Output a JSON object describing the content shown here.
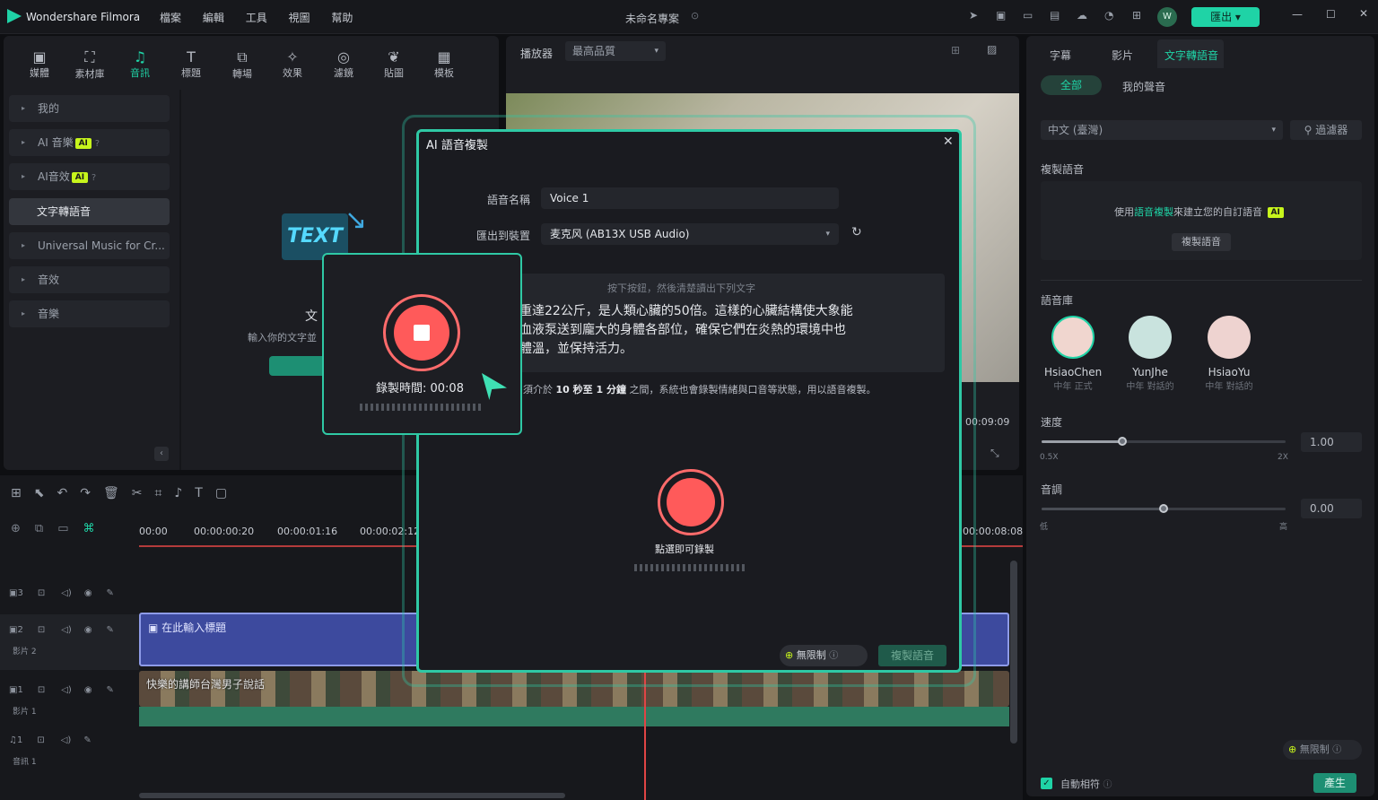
{
  "app": {
    "name": "Wondershare Filmora",
    "menu": [
      "檔案",
      "編輯",
      "工具",
      "視圖",
      "幫助"
    ],
    "project_title": "未命名專案",
    "export_label": "匯出",
    "user_initial": "W"
  },
  "toolbar": {
    "items": [
      "媒體",
      "素材庫",
      "音訊",
      "標題",
      "轉場",
      "效果",
      "濾鏡",
      "貼圖",
      "模板"
    ],
    "active": "音訊"
  },
  "library": {
    "categories": [
      {
        "label": "我的",
        "ai": false
      },
      {
        "label": "AI 音樂",
        "ai": true
      },
      {
        "label": "AI音效",
        "ai": true
      },
      {
        "label": "文字轉語音",
        "ai": false,
        "selected": true
      },
      {
        "label": "Universal Music for Cr...",
        "ai": false
      },
      {
        "label": "音效",
        "ai": false
      },
      {
        "label": "音樂",
        "ai": false
      }
    ],
    "ai_badge": "AI",
    "promo_title": "文",
    "promo_sub": "輸入你的文字並",
    "text_logo": "TEXT"
  },
  "player": {
    "label": "播放器",
    "quality": "最高品質",
    "time": "00:09:09"
  },
  "timeline": {
    "ticks": [
      "00:00",
      "00:00:00:20",
      "00:00:01:16",
      "00:00:02:12",
      "00:00:08:08"
    ],
    "tracks": [
      {
        "num": "3",
        "name": ""
      },
      {
        "num": "2",
        "name": "影片 2"
      },
      {
        "num": "1",
        "name": "影片 1"
      },
      {
        "num": "1",
        "name": "音訊 1"
      }
    ],
    "title_clip": "在此輸入標題",
    "video_clip": "快樂的講師台灣男子說話"
  },
  "dialog": {
    "title": "AI 語音複製",
    "name_label": "語音名稱",
    "name_value": "Voice 1",
    "device_label": "匯出到裝置",
    "device_value": "麦克风 (AB13X USB Audio)",
    "hint": "按下按鈕，然後清楚讀出下列文字",
    "script_lines": [
      "重達22公斤，是人類心臟的50倍。這樣的心臟結構使大象能",
      "血液泵送到龐大的身體各部位，確保它們在炎熱的環境中也",
      "體溫，並保持活力。"
    ],
    "duration_note_pre": "須介於",
    "duration_note_bold": "10 秒至 1 分鐘",
    "duration_note_post": "之間，系統也會錄製情緒與口音等狀態，用以語音複製。",
    "record_label": "點選即可錄製",
    "unlimited_label": "無限制",
    "clone_button": "複製語音"
  },
  "recording_popup": {
    "time_label": "錄製時間: 00:08"
  },
  "right_panel": {
    "tabs": [
      "字幕",
      "影片",
      "文字轉語音"
    ],
    "active_tab": "文字轉語音",
    "subtabs": [
      "全部",
      "我的聲音"
    ],
    "language": "中文 (臺灣)",
    "filter_label": "過濾器",
    "clone_section": "複製語音",
    "clone_hint_pre": "使用",
    "clone_hint_link": "語音複製",
    "clone_hint_post": "來建立您的自訂語音",
    "clone_button": "複製語音",
    "library_label": "語音庫",
    "voices": [
      {
        "name": "HsiaoChen",
        "desc": "中年 正式"
      },
      {
        "name": "YunJhe",
        "desc": "中年 對話的"
      },
      {
        "name": "HsiaoYu",
        "desc": "中年 對話的"
      }
    ],
    "speed_label": "速度",
    "speed_value": "1.00",
    "speed_min": "0.5X",
    "speed_max": "2X",
    "speed_level": 0.33,
    "pitch_label": "音調",
    "pitch_value": "0.00",
    "pitch_min": "低",
    "pitch_max": "高",
    "pitch_level": 0.5,
    "unlimited_label": "無限制",
    "auto_match_label": "自動相符",
    "generate_label": "產生"
  },
  "colors": {
    "accent": "#1fd3a6",
    "record": "#ff5a5a",
    "title_clip": "#3d4a9e"
  }
}
